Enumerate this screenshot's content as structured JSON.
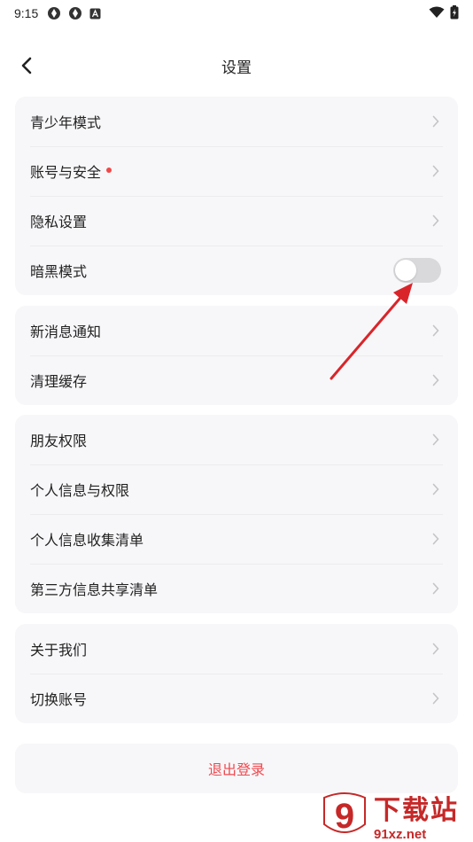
{
  "status_bar": {
    "time": "9:15"
  },
  "nav": {
    "title": "设置"
  },
  "groups": [
    {
      "items": [
        {
          "label": "青少年模式",
          "type": "link"
        },
        {
          "label": "账号与安全",
          "type": "link",
          "badge": "red-dot"
        },
        {
          "label": "隐私设置",
          "type": "link"
        },
        {
          "label": "暗黑模式",
          "type": "toggle",
          "on": false
        }
      ]
    },
    {
      "items": [
        {
          "label": "新消息通知",
          "type": "link"
        },
        {
          "label": "清理缓存",
          "type": "link"
        }
      ]
    },
    {
      "items": [
        {
          "label": "朋友权限",
          "type": "link"
        },
        {
          "label": "个人信息与权限",
          "type": "link"
        },
        {
          "label": "个人信息收集清单",
          "type": "link"
        },
        {
          "label": "第三方信息共享清单",
          "type": "link"
        }
      ]
    },
    {
      "items": [
        {
          "label": "关于我们",
          "type": "link"
        },
        {
          "label": "切换账号",
          "type": "link"
        }
      ]
    }
  ],
  "logout": {
    "label": "退出登录"
  },
  "watermark": {
    "brand": "下载站",
    "url": "91xz.net",
    "logo_glyph": "9"
  },
  "colors": {
    "accent_red": "#f04848",
    "logout_text": "#f0494f",
    "chevron": "#c4c4c8",
    "annotation_arrow": "#d9252a"
  },
  "icons": {
    "back": "chevron-left-icon",
    "row_chevron": "chevron-right-icon",
    "wifi": "wifi-icon",
    "battery": "battery-icon"
  }
}
